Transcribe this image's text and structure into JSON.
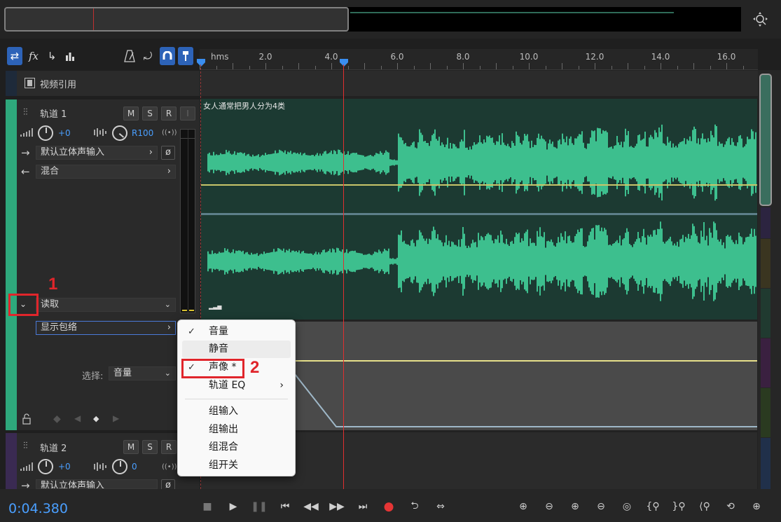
{
  "ruler": {
    "unit": "hms",
    "ticks": [
      "2.0",
      "4.0",
      "6.0",
      "8.0",
      "10.0",
      "12.0",
      "14.0",
      "16.0"
    ]
  },
  "video_track": {
    "label": "视频引用"
  },
  "track1": {
    "name": "轨道 1",
    "mute": "M",
    "solo": "S",
    "record": "R",
    "input_mon": "I",
    "volume": "+0",
    "pan": "R100",
    "input": "默认立体声输入",
    "output": "混合",
    "automation_mode": "读取",
    "show_envelopes": "显示包络",
    "select_label": "选择:",
    "select_value": "音量",
    "clip_title": "女人通常把男人分为4类"
  },
  "track2": {
    "name": "轨道 2",
    "mute": "M",
    "solo": "S",
    "record": "R",
    "volume": "+0",
    "pan": "0",
    "input": "默认立体声输入"
  },
  "context_menu": {
    "items": [
      {
        "label": "音量",
        "checked": true
      },
      {
        "label": "静音",
        "checked": false
      },
      {
        "label": "声像 *",
        "checked": true
      },
      {
        "label": "轨道 EQ",
        "checked": false,
        "submenu": true
      },
      {
        "label": "组输入",
        "checked": false
      },
      {
        "label": "组输出",
        "checked": false
      },
      {
        "label": "组混合",
        "checked": false
      },
      {
        "label": "组开关",
        "checked": false
      }
    ]
  },
  "annotations": {
    "one": "1",
    "two": "2"
  },
  "transport": {
    "time": "0:04.380"
  },
  "colors": {
    "accent": "#4a9fff",
    "waveform": "#3dbf8e",
    "track1": "#2ea87c",
    "playhead": "#e03030",
    "annotation": "#e0252b"
  }
}
